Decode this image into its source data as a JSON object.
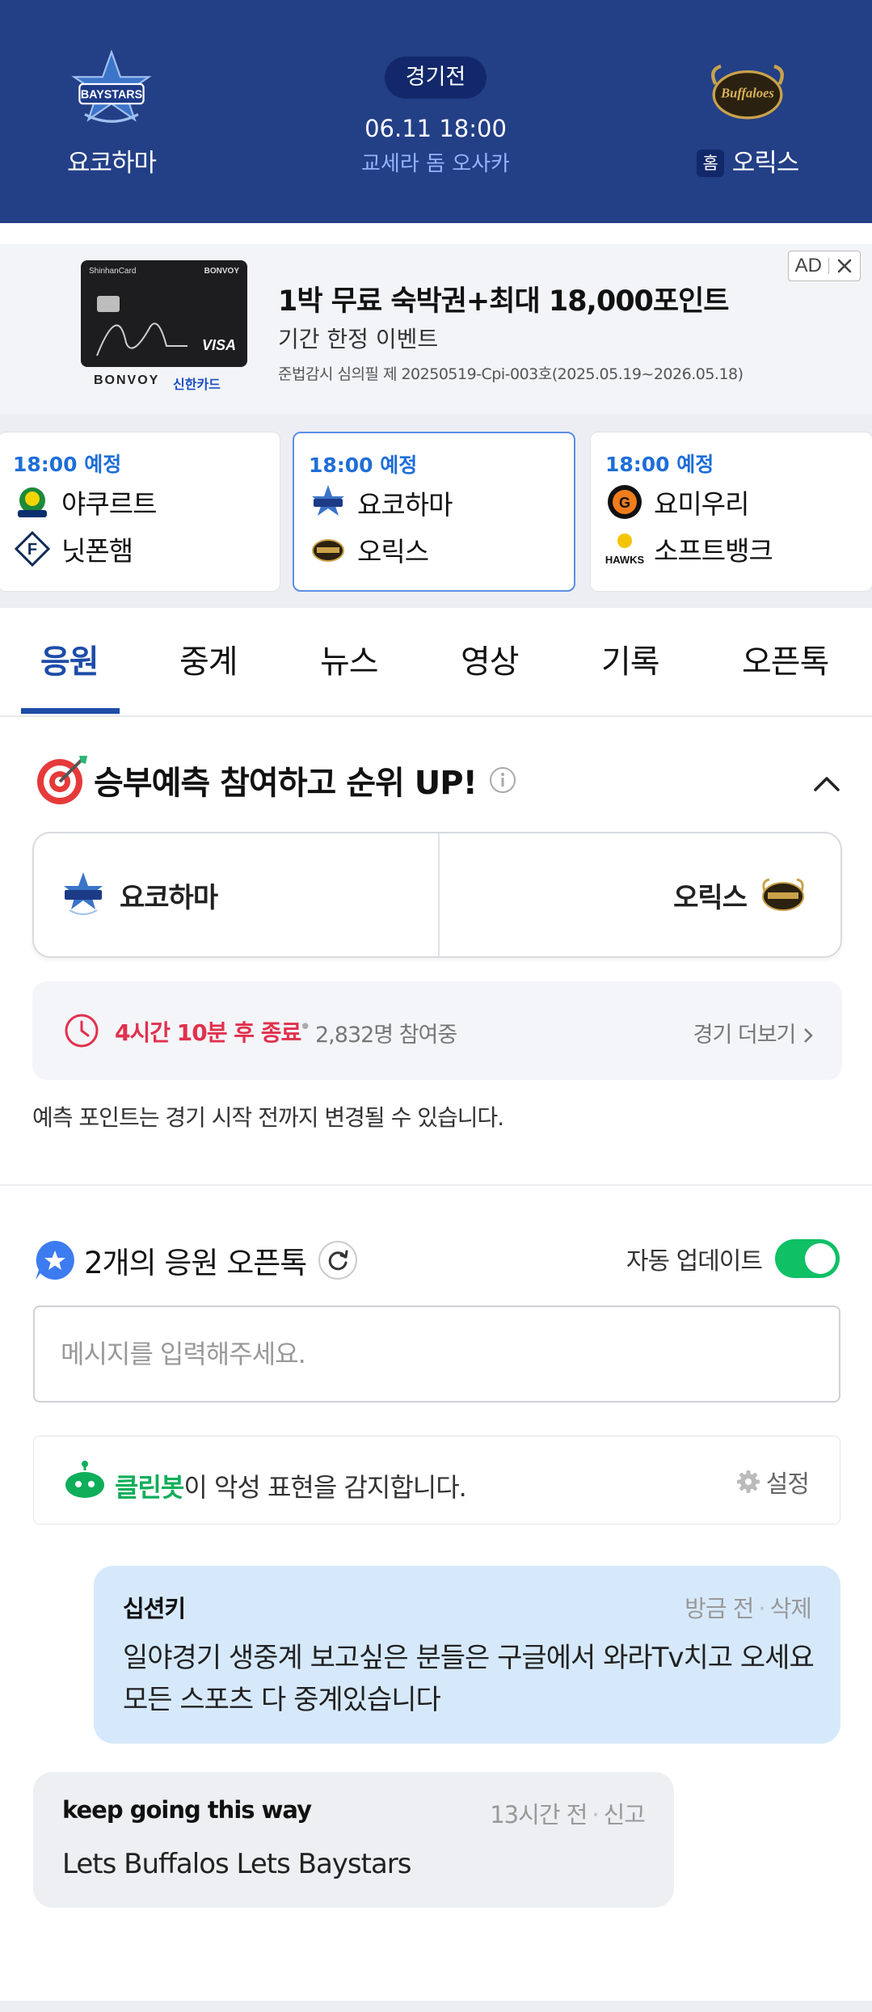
{
  "header": {
    "away_team": "요코하마",
    "home_team": "오릭스",
    "home_badge": "홈",
    "status": "경기전",
    "datetime": "06.11 18:00",
    "venue": "교세라 돔 오사카",
    "bg_color": "#233f86"
  },
  "ad": {
    "title": "1박 무료 숙박권+최대 18,000포인트",
    "subtitle": "기간 한정 이벤트",
    "fine_print": "준법감시 심의필 제 20250519-Cpi-003호(2025.05.19~2026.05.18)",
    "badge_label": "AD",
    "close_icon": "close-icon",
    "card_brand": "BONVOY",
    "card_issuer": "ShinhanCard",
    "card_network": "VISA",
    "brand_bonvoy": "BONVOY",
    "brand_shinhan": "신한카드"
  },
  "schedule": {
    "games": [
      {
        "time": "18:00 예정",
        "team1": "야쿠르트",
        "team2": "닛폰햄",
        "active": false
      },
      {
        "time": "18:00 예정",
        "team1": "요코하마",
        "team2": "오릭스",
        "active": true
      },
      {
        "time": "18:00 예정",
        "team1": "요미우리",
        "team2": "소프트뱅크",
        "active": false
      }
    ]
  },
  "tabs": [
    "응원",
    "중계",
    "뉴스",
    "영상",
    "기록",
    "오픈톡"
  ],
  "active_tab": "응원",
  "prediction": {
    "title": "승부예측 참여하고 순위 UP!",
    "left_team": "요코하마",
    "right_team": "오릭스",
    "deadline": "4시간 10분 후 종료",
    "separator": "•",
    "participants": "2,832명 참여중",
    "more_link": "경기 더보기",
    "note": "예측 포인트는 경기 시작 전까지 변경될 수 있습니다."
  },
  "open_talk": {
    "title": "2개의 응원 오픈톡",
    "auto_update_label": "자동 업데이트",
    "auto_update_on": true,
    "input_placeholder": "메시지를 입력해주세요.",
    "cleanbot_name": "클린봇",
    "cleanbot_text": "이 악성 표현을 감지합니다.",
    "settings_label": "설정",
    "messages": [
      {
        "author": "십션키",
        "time": "방금 전",
        "action": "삭제",
        "text": "일야경기 생중계 보고싶은 분들은 구글에서 와라Tv치고 오세요 모든 스포츠 다 중계있습니다",
        "mine": true
      },
      {
        "author": "keep going this way",
        "time": "13시간 전",
        "action": "신고",
        "text": "Lets Buffalos Lets Baystars",
        "mine": false
      }
    ],
    "meta_separator": "·"
  },
  "colors": {
    "accent_blue": "#1e4ca8",
    "time_blue": "#1e6ed8",
    "deadline_red": "#e0314e",
    "toggle_green": "#0fc065",
    "cleanbot_green": "#0fae5a",
    "my_bubble": "#d6e9fb"
  }
}
